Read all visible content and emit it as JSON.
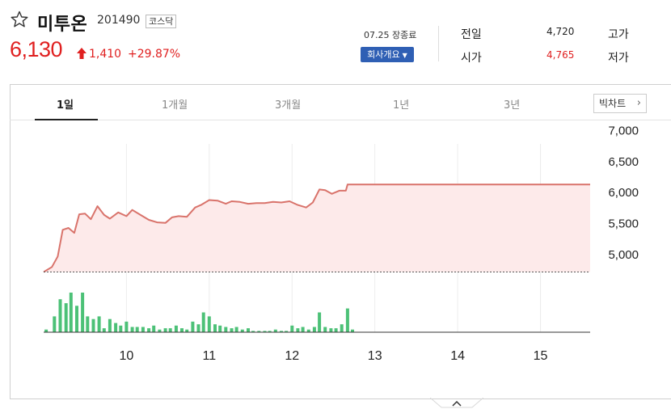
{
  "stock": {
    "name": "미투온",
    "code": "201490",
    "market": "코스닥",
    "price": "6,130",
    "change": "1,410",
    "change_rate": "+29.87%"
  },
  "status": {
    "date": "07.25",
    "label": "장종료",
    "company_info_label": "회사개요"
  },
  "quotes": {
    "prev_close_label": "전일",
    "prev_close": "4,720",
    "open_label": "시가",
    "open": "4,765",
    "high_label": "고가",
    "low_label": "저가"
  },
  "tabs": [
    {
      "label": "1일",
      "active": true
    },
    {
      "label": "1개월",
      "active": false
    },
    {
      "label": "3개월",
      "active": false
    },
    {
      "label": "1년",
      "active": false
    },
    {
      "label": "3년",
      "active": false
    }
  ],
  "big_chart_label": "빅차트",
  "colors": {
    "up": "#e02020",
    "price_line": "#d9736b",
    "price_fill": "#fdeaea",
    "volume_bar": "#4cc177",
    "accent_button": "#2f5fb4"
  },
  "icons": {
    "favorite": "star-outline-icon",
    "change": "arrow-up-icon",
    "big_chart": "chevron-right-icon",
    "expand": "chevron-up-icon"
  },
  "chart_data": {
    "type": "line",
    "y_ticks": [
      "7,000",
      "6,500",
      "6,000",
      "5,500",
      "5,000"
    ],
    "y_tick_values": [
      7000,
      6500,
      6000,
      5500,
      5000
    ],
    "ylim": [
      4700,
      7150
    ],
    "x_ticks": [
      "10",
      "11",
      "12",
      "13",
      "14",
      "15"
    ],
    "x_tick_values": [
      10,
      11,
      12,
      13,
      14,
      15
    ],
    "xlim": [
      9.0,
      15.6
    ],
    "baseline": 4720,
    "price_series": {
      "x": [
        9.0,
        9.1,
        9.17,
        9.23,
        9.3,
        9.37,
        9.43,
        9.5,
        9.57,
        9.65,
        9.73,
        9.8,
        9.9,
        10.0,
        10.07,
        10.17,
        10.27,
        10.37,
        10.47,
        10.55,
        10.63,
        10.73,
        10.83,
        10.9,
        11.0,
        11.1,
        11.2,
        11.27,
        11.37,
        11.47,
        11.57,
        11.67,
        11.77,
        11.87,
        11.97,
        12.07,
        12.17,
        12.25,
        12.33,
        12.4,
        12.48,
        12.57,
        12.65,
        12.67,
        15.6
      ],
      "values": [
        4720,
        4800,
        4970,
        5400,
        5430,
        5350,
        5650,
        5660,
        5570,
        5780,
        5640,
        5580,
        5680,
        5620,
        5720,
        5640,
        5560,
        5520,
        5510,
        5600,
        5620,
        5610,
        5760,
        5800,
        5880,
        5870,
        5820,
        5860,
        5850,
        5820,
        5830,
        5830,
        5850,
        5840,
        5860,
        5800,
        5760,
        5840,
        6050,
        6040,
        5980,
        6030,
        6030,
        6130,
        6130
      ]
    },
    "volume_series": {
      "x": [
        9.03,
        9.13,
        9.2,
        9.27,
        9.33,
        9.4,
        9.47,
        9.53,
        9.6,
        9.67,
        9.73,
        9.8,
        9.87,
        9.93,
        10.0,
        10.07,
        10.13,
        10.2,
        10.27,
        10.33,
        10.4,
        10.47,
        10.53,
        10.6,
        10.67,
        10.73,
        10.8,
        10.87,
        10.93,
        11.0,
        11.07,
        11.13,
        11.2,
        11.27,
        11.33,
        11.4,
        11.47,
        11.53,
        11.6,
        11.67,
        11.73,
        11.8,
        11.87,
        11.93,
        12.0,
        12.07,
        12.13,
        12.2,
        12.27,
        12.33,
        12.4,
        12.47,
        12.53,
        12.6,
        12.67,
        12.73
      ],
      "values": [
        2,
        12,
        25,
        22,
        30,
        20,
        30,
        12,
        10,
        12,
        3,
        10,
        7,
        5,
        8,
        4,
        4,
        4,
        3,
        5,
        2,
        3,
        3,
        5,
        3,
        2,
        8,
        6,
        15,
        12,
        6,
        5,
        4,
        3,
        4,
        2,
        3,
        1,
        1,
        1,
        1,
        2,
        1,
        1,
        5,
        3,
        4,
        2,
        4,
        15,
        4,
        3,
        3,
        6,
        18,
        2
      ]
    }
  }
}
